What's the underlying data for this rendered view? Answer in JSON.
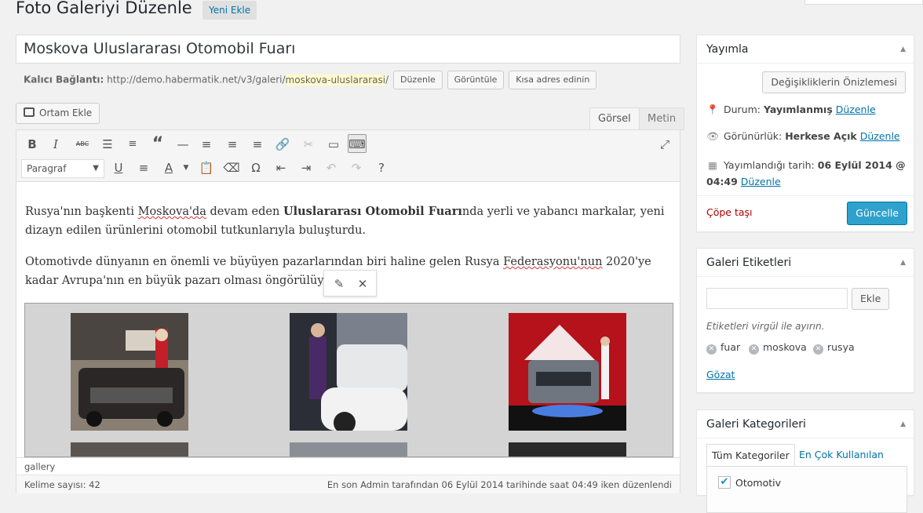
{
  "header": {
    "title": "Foto Galeriyi Düzenle",
    "add_new": "Yeni Ekle"
  },
  "post_title": "Moskova Uluslararası Otomobil Fuarı",
  "permalink": {
    "label": "Kalıcı Bağlantı:",
    "url_base": "http://demo.habermatik.net/v3/galeri/",
    "slug": "moskova-uluslararasi",
    "url_end": "/",
    "edit_btn": "Düzenle",
    "view_btn": "Görüntüle",
    "short_btn": "Kısa adres edinin"
  },
  "editor": {
    "add_media": "Ortam Ekle",
    "tab_visual": "Görsel",
    "tab_text": "Metin",
    "format_select": "Paragraf",
    "para1_a": "Rusya'nın başkenti ",
    "para1_b": "Moskova'da",
    "para1_c": " devam eden ",
    "para1_bold": "Uluslararası Otomobil Fuarı",
    "para1_d": "nda yerli ve yabancı markalar, yeni dizayn edilen ürünlerini otomobil tutkunlarıyla buluşturdu.",
    "para2_a": "Otomotivde dünyanın en önemli ve büyüyen pazarlarından biri haline gelen Rusya ",
    "para2_b": "Federasyonu'nun",
    "para2_c": " 2020'ye kadar Avrupa'nın en büyük pazarı olması öngörülüyor.",
    "path": "gallery",
    "word_count": "Kelime sayısı: 42",
    "last_edit": "En son Admin tarafından 06 Eylül 2014 tarihinde saat 04:49 iken düzenlendi"
  },
  "publish_box": {
    "title": "Yayımla",
    "preview_btn": "Değişikliklerin Önizlemesi",
    "status_label": "Durum:",
    "status_value": "Yayımlanmış",
    "visibility_label": "Görünürlük:",
    "visibility_value": "Herkese Açık",
    "date_label": "Yayımlandığı tarih:",
    "date_value_1": "06 Eylül 2014 @",
    "date_value_2": "04:49",
    "edit_link": "Düzenle",
    "trash": "Çöpe taşı",
    "update_btn": "Güncelle"
  },
  "tags_box": {
    "title": "Galeri Etiketleri",
    "add_btn": "Ekle",
    "hint": "Etiketleri virgül ile ayırın.",
    "tags": [
      "fuar",
      "moskova",
      "rusya"
    ],
    "browse": "Gözat"
  },
  "categories_box": {
    "title": "Galeri Kategorileri",
    "tab_all": "Tüm Kategoriler",
    "tab_popular": "En Çok Kullanılan",
    "items": [
      {
        "label": "Otomotiv",
        "checked": true
      }
    ]
  }
}
